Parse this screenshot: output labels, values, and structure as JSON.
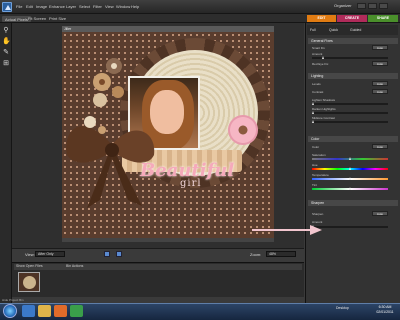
{
  "menu": {
    "items": [
      "File",
      "Edit",
      "Image",
      "Enhance",
      "Layer",
      "Select",
      "Filter",
      "View",
      "Window",
      "Help"
    ],
    "organizer": "Organizer"
  },
  "modes": {
    "edit": "EDIT",
    "create": "CREATE",
    "share": "SHARE"
  },
  "toolbar2": {
    "actual_pixels": "Actual Pixels",
    "fit_screen": "Fit Screen",
    "print_size": "Print Size"
  },
  "document": {
    "tab_title": "Jiller"
  },
  "canvas_text": {
    "script": "Beautiful",
    "sub": "girl"
  },
  "options": {
    "view_label": "View:",
    "view_value": "After Only",
    "zoom_label": "Zoom:",
    "zoom_value": "48%"
  },
  "bin": {
    "select_label": "Show Open Files",
    "actions_label": "Bin Actions",
    "status": "Hide Project Bin"
  },
  "panel": {
    "tabs": {
      "full": "Full",
      "quick": "Quick",
      "guided": "Guided"
    },
    "sections": {
      "general": "General Fixes",
      "lighting": "Lighting",
      "color": "Color",
      "sharpen": "Sharpen"
    },
    "labels": {
      "smart_fix": "Smart Fix",
      "amount": "Amount",
      "red_eye": "Red Eye Fix",
      "levels": "Levels",
      "contrast": "Contrast",
      "lighten_shadows": "Lighten Shadows",
      "darken_highlights": "Darken Highlights",
      "midtone_contrast": "Midtone Contrast",
      "color": "Color",
      "saturation": "Saturation",
      "hue": "Hue",
      "temperature": "Temperature",
      "tint": "Tint",
      "sharpen": "Sharpen",
      "amount2": "Amount"
    },
    "auto": "Auto"
  },
  "taskbar": {
    "tray": "Desktop",
    "time": "6:30 AM",
    "date": "02/01/2011"
  },
  "colors": {
    "edit": "#e07b12",
    "create": "#b02b5a",
    "share": "#4a8f2b",
    "panel": "#333333"
  }
}
